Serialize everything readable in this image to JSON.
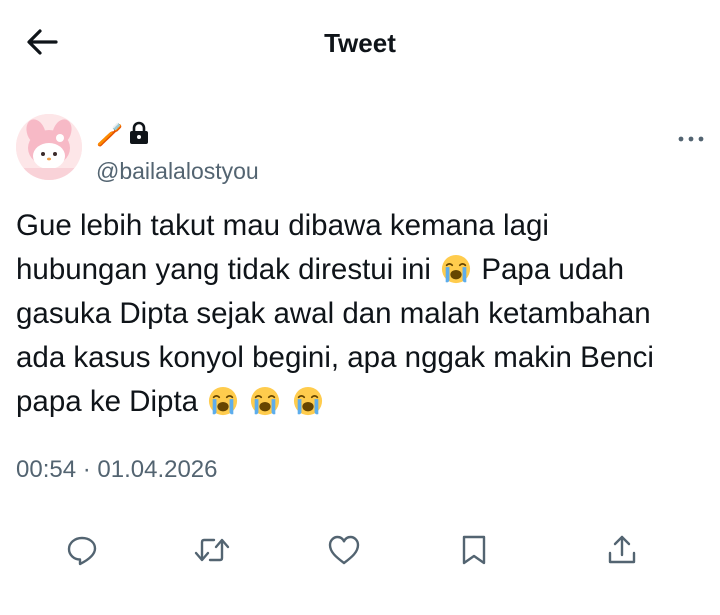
{
  "header": {
    "title": "Tweet",
    "back_icon": "arrow-left-icon"
  },
  "author": {
    "name_glyph": "🪥",
    "protected_icon": "lock-icon",
    "handle": "@bailalalostyou",
    "more_icon": "more-horizontal-icon"
  },
  "tweet": {
    "lines": [
      "Gue lebih takut mau dibawa kemana lagi",
      "hubungan yang tidak direstui ini",
      "Papa udah",
      "gasuka Dipta sejak awal dan malah ketambahan",
      "ada kasus konyol begini, apa nggak makin Benci",
      "papa ke Dipta"
    ],
    "emoji": "loudly-crying-face-emoji"
  },
  "meta": {
    "timestamp": "00:54 · 01.04.2026"
  },
  "actions": {
    "reply_icon": "reply-icon",
    "retweet_icon": "retweet-icon",
    "like_icon": "heart-icon",
    "bookmark_icon": "bookmark-icon",
    "share_icon": "share-icon"
  },
  "colors": {
    "text": "#0f1419",
    "secondary": "#536471",
    "background": "#ffffff"
  }
}
